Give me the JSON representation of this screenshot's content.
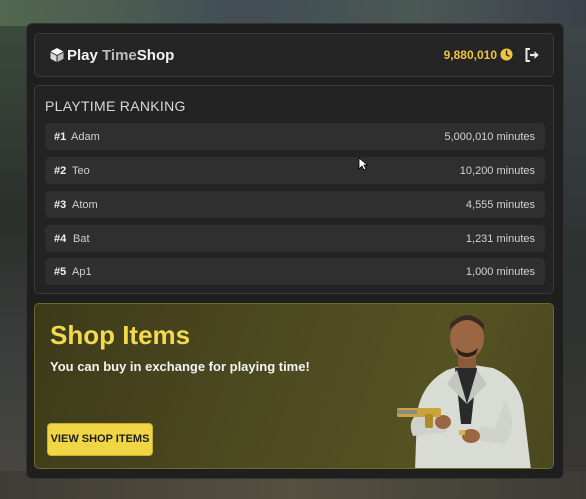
{
  "header": {
    "title_part1": "Play",
    "title_part2": "Time",
    "title_part3": "Shop",
    "balance": "9,880,010",
    "icons": [
      "cube-icon",
      "clock-icon",
      "exit-icon"
    ],
    "accent_color": "#f0c43a"
  },
  "ranking": {
    "title": "PLAYTIME RANKING",
    "rows": [
      {
        "rank": "#1",
        "name": "Adam",
        "minutes": "5,000,010 minutes"
      },
      {
        "rank": "#2",
        "name": "Teo",
        "minutes": "10,200 minutes"
      },
      {
        "rank": "#3",
        "name": "Atom",
        "minutes": "4,555 minutes"
      },
      {
        "rank": "#4",
        "name": "Bat",
        "minutes": "1,231 minutes"
      },
      {
        "rank": "#5",
        "name": "Ap1",
        "minutes": "1,000 minutes"
      }
    ]
  },
  "shop": {
    "title": "Shop Items",
    "subtitle": "You can buy in exchange for playing time!",
    "button_label": "VIEW SHOP ITEMS",
    "title_color": "#f3d94c",
    "button_color": "#f0d545"
  }
}
